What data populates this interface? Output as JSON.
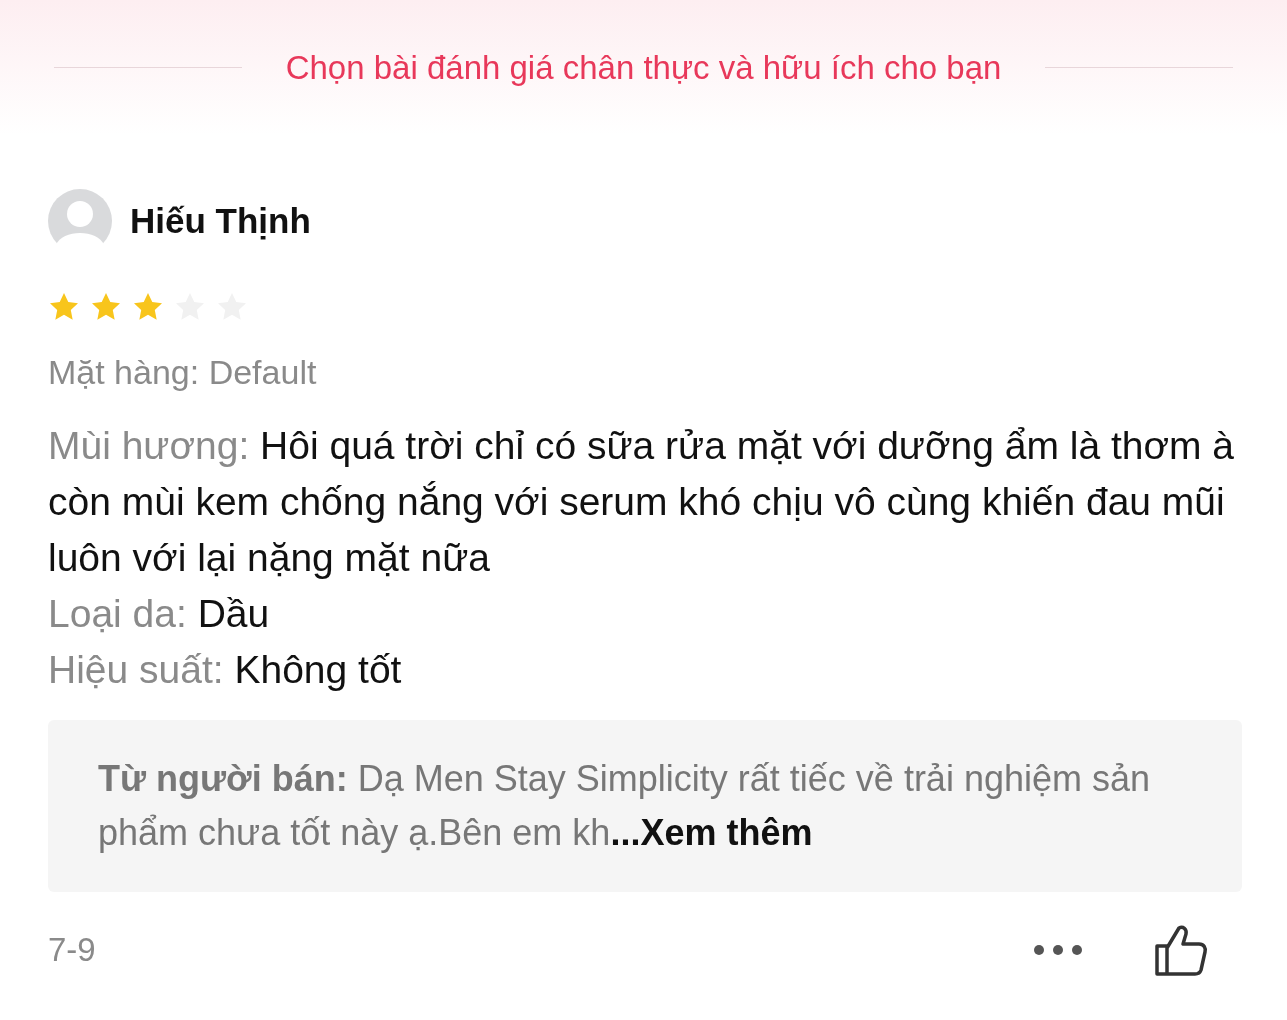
{
  "header": {
    "title": "Chọn bài đánh giá chân thực và hữu ích cho bạn"
  },
  "review": {
    "author": "Hiếu Thịnh",
    "stars": 3,
    "variant": "Mặt hàng: Default",
    "attributes": [
      {
        "label": "Mùi hương:",
        "value": "Hôi quá trời chỉ có sữa rửa mặt với dưỡng ẩm là thơm à còn mùi kem chống nắng với serum khó chịu vô cùng khiến đau mũi luôn với lại nặng mặt nữa"
      },
      {
        "label": "Loại da:",
        "value": "Dầu"
      },
      {
        "label": "Hiệu suất:",
        "value": "Không tốt"
      }
    ],
    "seller_reply": {
      "text": "**Từ người bán:** Dạ Men Stay Simplicity rất tiếc về trải nghiệm sản phẩm chưa tốt này ạ.Bên em kh",
      "more": "...Xem thêm"
    },
    "date": "7-9"
  }
}
